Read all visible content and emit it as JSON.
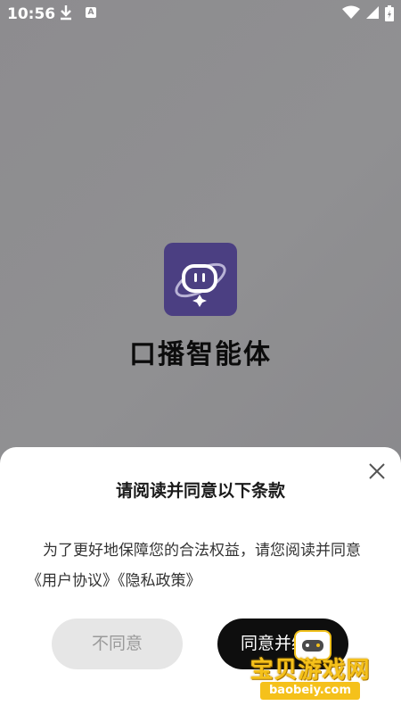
{
  "status_bar": {
    "time": "10:56",
    "download_icon": "download-arrow-icon",
    "notification_icon": "A"
  },
  "splash": {
    "app_name": "口播智能体",
    "logo_color": "#4b3f82"
  },
  "dialog": {
    "title": "请阅读并同意以下条款",
    "body_text": "为了更好地保障您的合法权益，请您阅读并同意",
    "user_agreement_link": "《用户协议》",
    "privacy_policy_link": "《隐私政策》",
    "disagree_label": "不同意",
    "agree_label": "同意并继续"
  },
  "watermark": {
    "text": "宝贝游戏网",
    "url": "baobeiy.com"
  },
  "colors": {
    "overlay": "#8a898c",
    "agree_button": "#0e0e0e",
    "disagree_button": "#e6e6e6",
    "watermark": "#f5c11b"
  }
}
